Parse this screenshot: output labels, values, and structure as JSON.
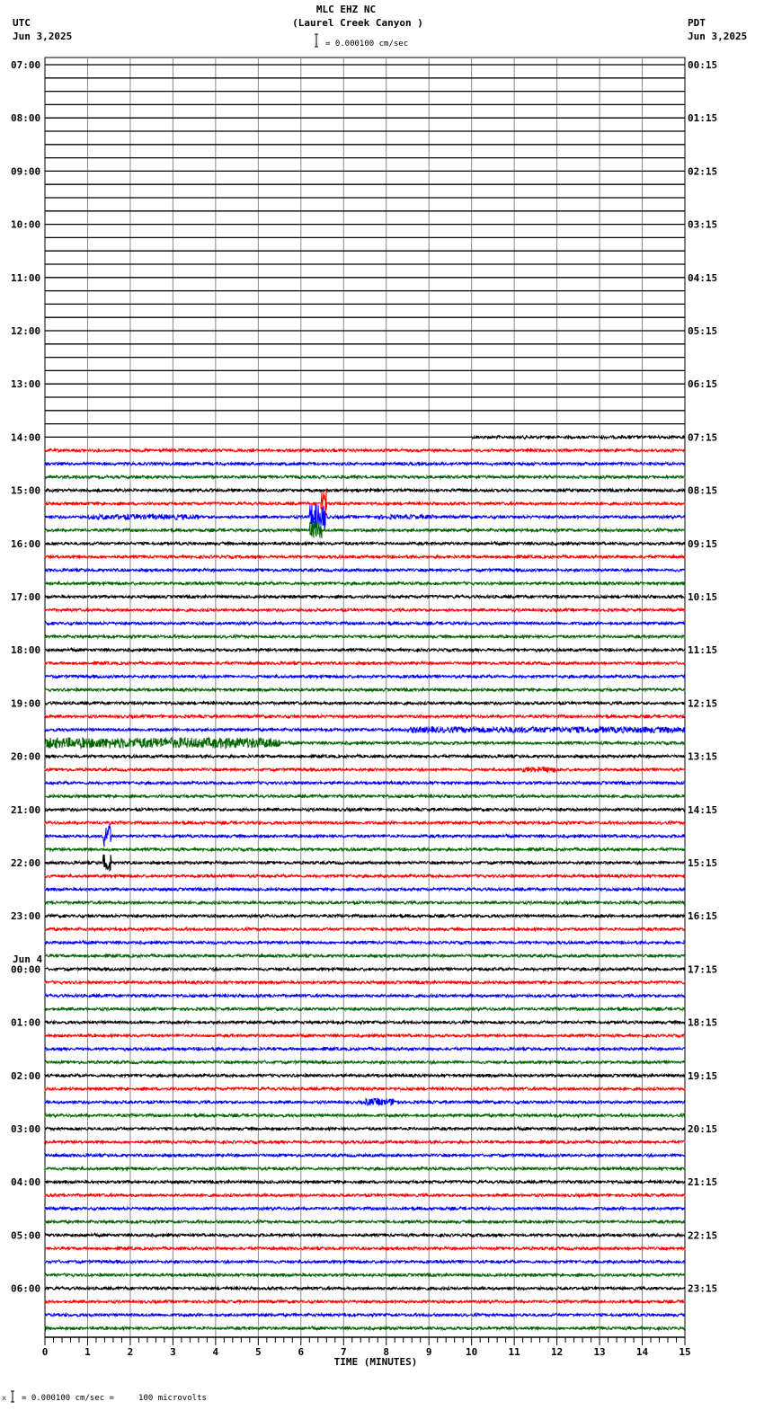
{
  "header": {
    "station": "MLC EHZ NC",
    "location": "(Laurel Creek Canyon )",
    "left_tz": "UTC",
    "left_date": "Jun 3,2025",
    "right_tz": "PDT",
    "right_date": "Jun 3,2025",
    "scale": "= 0.000100 cm/sec"
  },
  "footer": {
    "scale": "= 0.000100 cm/sec =     100 microvolts",
    "marker": "⌅"
  },
  "chart_data": {
    "type": "helicorder",
    "title": "MLC EHZ NC (Laurel Creek Canyon )",
    "xlabel": "TIME (MINUTES)",
    "xlim": [
      0,
      15
    ],
    "x_ticks": [
      "0",
      "1",
      "2",
      "3",
      "4",
      "5",
      "6",
      "7",
      "8",
      "9",
      "10",
      "11",
      "12",
      "13",
      "14",
      "15"
    ],
    "minutes_per_line": 15,
    "line_count": 96,
    "colors": [
      "#000000",
      "#ff0000",
      "#0000ff",
      "#006400"
    ],
    "utc_labels": [
      "07:00",
      "08:00",
      "09:00",
      "10:00",
      "11:00",
      "12:00",
      "13:00",
      "14:00",
      "15:00",
      "16:00",
      "17:00",
      "18:00",
      "19:00",
      "20:00",
      "21:00",
      "22:00",
      "23:00",
      "00:00",
      "01:00",
      "02:00",
      "03:00",
      "04:00",
      "05:00",
      "06:00"
    ],
    "date_change_label": "Jun 4",
    "pdt_labels": [
      "00:15",
      "01:15",
      "02:15",
      "03:15",
      "04:15",
      "05:15",
      "06:15",
      "07:15",
      "08:15",
      "09:15",
      "10:15",
      "11:15",
      "12:15",
      "13:15",
      "14:15",
      "15:15",
      "16:15",
      "17:15",
      "18:15",
      "19:15",
      "20:15",
      "21:15",
      "22:15",
      "23:15"
    ],
    "data_start": {
      "line": 28,
      "minute": 10
    },
    "events": [
      {
        "line": 34,
        "start": 1.0,
        "end": 3.6,
        "amp": 3
      },
      {
        "line": 34,
        "start": 6.2,
        "end": 6.6,
        "amp": 14
      },
      {
        "line": 34,
        "start": 7.8,
        "end": 9.2,
        "amp": 2.5
      },
      {
        "line": 33,
        "start": 6.45,
        "end": 6.6,
        "amp": 18
      },
      {
        "line": 35,
        "start": 6.2,
        "end": 6.5,
        "amp": 10
      },
      {
        "line": 50,
        "start": 8.5,
        "end": 15,
        "amp": 3.5
      },
      {
        "line": 51,
        "start": 0,
        "end": 5.5,
        "amp": 6
      },
      {
        "line": 53,
        "start": 11.2,
        "end": 12.0,
        "amp": 3
      },
      {
        "line": 58,
        "start": 1.35,
        "end": 1.55,
        "amp": 14
      },
      {
        "line": 60,
        "start": 1.35,
        "end": 1.55,
        "amp": 12
      },
      {
        "line": 78,
        "start": 7.5,
        "end": 8.3,
        "amp": 4
      }
    ]
  }
}
